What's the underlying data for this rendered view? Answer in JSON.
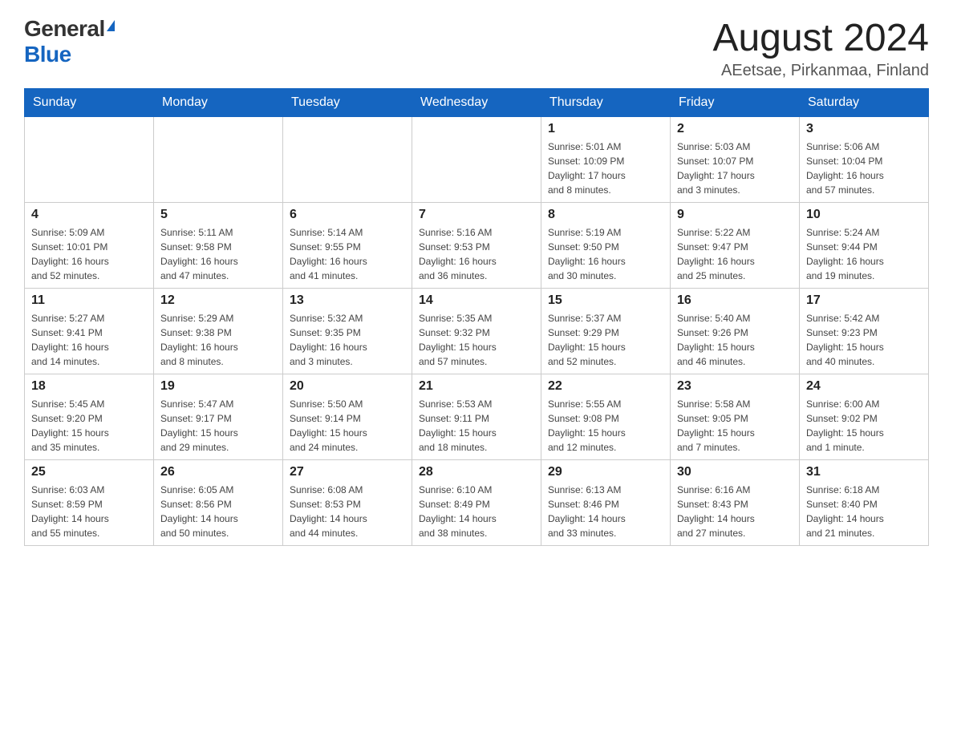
{
  "logo": {
    "general": "General",
    "blue": "Blue"
  },
  "title": {
    "month": "August 2024",
    "location": "AEetsae, Pirkanmaa, Finland"
  },
  "headers": [
    "Sunday",
    "Monday",
    "Tuesday",
    "Wednesday",
    "Thursday",
    "Friday",
    "Saturday"
  ],
  "weeks": [
    [
      {
        "day": "",
        "info": ""
      },
      {
        "day": "",
        "info": ""
      },
      {
        "day": "",
        "info": ""
      },
      {
        "day": "",
        "info": ""
      },
      {
        "day": "1",
        "info": "Sunrise: 5:01 AM\nSunset: 10:09 PM\nDaylight: 17 hours\nand 8 minutes."
      },
      {
        "day": "2",
        "info": "Sunrise: 5:03 AM\nSunset: 10:07 PM\nDaylight: 17 hours\nand 3 minutes."
      },
      {
        "day": "3",
        "info": "Sunrise: 5:06 AM\nSunset: 10:04 PM\nDaylight: 16 hours\nand 57 minutes."
      }
    ],
    [
      {
        "day": "4",
        "info": "Sunrise: 5:09 AM\nSunset: 10:01 PM\nDaylight: 16 hours\nand 52 minutes."
      },
      {
        "day": "5",
        "info": "Sunrise: 5:11 AM\nSunset: 9:58 PM\nDaylight: 16 hours\nand 47 minutes."
      },
      {
        "day": "6",
        "info": "Sunrise: 5:14 AM\nSunset: 9:55 PM\nDaylight: 16 hours\nand 41 minutes."
      },
      {
        "day": "7",
        "info": "Sunrise: 5:16 AM\nSunset: 9:53 PM\nDaylight: 16 hours\nand 36 minutes."
      },
      {
        "day": "8",
        "info": "Sunrise: 5:19 AM\nSunset: 9:50 PM\nDaylight: 16 hours\nand 30 minutes."
      },
      {
        "day": "9",
        "info": "Sunrise: 5:22 AM\nSunset: 9:47 PM\nDaylight: 16 hours\nand 25 minutes."
      },
      {
        "day": "10",
        "info": "Sunrise: 5:24 AM\nSunset: 9:44 PM\nDaylight: 16 hours\nand 19 minutes."
      }
    ],
    [
      {
        "day": "11",
        "info": "Sunrise: 5:27 AM\nSunset: 9:41 PM\nDaylight: 16 hours\nand 14 minutes."
      },
      {
        "day": "12",
        "info": "Sunrise: 5:29 AM\nSunset: 9:38 PM\nDaylight: 16 hours\nand 8 minutes."
      },
      {
        "day": "13",
        "info": "Sunrise: 5:32 AM\nSunset: 9:35 PM\nDaylight: 16 hours\nand 3 minutes."
      },
      {
        "day": "14",
        "info": "Sunrise: 5:35 AM\nSunset: 9:32 PM\nDaylight: 15 hours\nand 57 minutes."
      },
      {
        "day": "15",
        "info": "Sunrise: 5:37 AM\nSunset: 9:29 PM\nDaylight: 15 hours\nand 52 minutes."
      },
      {
        "day": "16",
        "info": "Sunrise: 5:40 AM\nSunset: 9:26 PM\nDaylight: 15 hours\nand 46 minutes."
      },
      {
        "day": "17",
        "info": "Sunrise: 5:42 AM\nSunset: 9:23 PM\nDaylight: 15 hours\nand 40 minutes."
      }
    ],
    [
      {
        "day": "18",
        "info": "Sunrise: 5:45 AM\nSunset: 9:20 PM\nDaylight: 15 hours\nand 35 minutes."
      },
      {
        "day": "19",
        "info": "Sunrise: 5:47 AM\nSunset: 9:17 PM\nDaylight: 15 hours\nand 29 minutes."
      },
      {
        "day": "20",
        "info": "Sunrise: 5:50 AM\nSunset: 9:14 PM\nDaylight: 15 hours\nand 24 minutes."
      },
      {
        "day": "21",
        "info": "Sunrise: 5:53 AM\nSunset: 9:11 PM\nDaylight: 15 hours\nand 18 minutes."
      },
      {
        "day": "22",
        "info": "Sunrise: 5:55 AM\nSunset: 9:08 PM\nDaylight: 15 hours\nand 12 minutes."
      },
      {
        "day": "23",
        "info": "Sunrise: 5:58 AM\nSunset: 9:05 PM\nDaylight: 15 hours\nand 7 minutes."
      },
      {
        "day": "24",
        "info": "Sunrise: 6:00 AM\nSunset: 9:02 PM\nDaylight: 15 hours\nand 1 minute."
      }
    ],
    [
      {
        "day": "25",
        "info": "Sunrise: 6:03 AM\nSunset: 8:59 PM\nDaylight: 14 hours\nand 55 minutes."
      },
      {
        "day": "26",
        "info": "Sunrise: 6:05 AM\nSunset: 8:56 PM\nDaylight: 14 hours\nand 50 minutes."
      },
      {
        "day": "27",
        "info": "Sunrise: 6:08 AM\nSunset: 8:53 PM\nDaylight: 14 hours\nand 44 minutes."
      },
      {
        "day": "28",
        "info": "Sunrise: 6:10 AM\nSunset: 8:49 PM\nDaylight: 14 hours\nand 38 minutes."
      },
      {
        "day": "29",
        "info": "Sunrise: 6:13 AM\nSunset: 8:46 PM\nDaylight: 14 hours\nand 33 minutes."
      },
      {
        "day": "30",
        "info": "Sunrise: 6:16 AM\nSunset: 8:43 PM\nDaylight: 14 hours\nand 27 minutes."
      },
      {
        "day": "31",
        "info": "Sunrise: 6:18 AM\nSunset: 8:40 PM\nDaylight: 14 hours\nand 21 minutes."
      }
    ]
  ]
}
